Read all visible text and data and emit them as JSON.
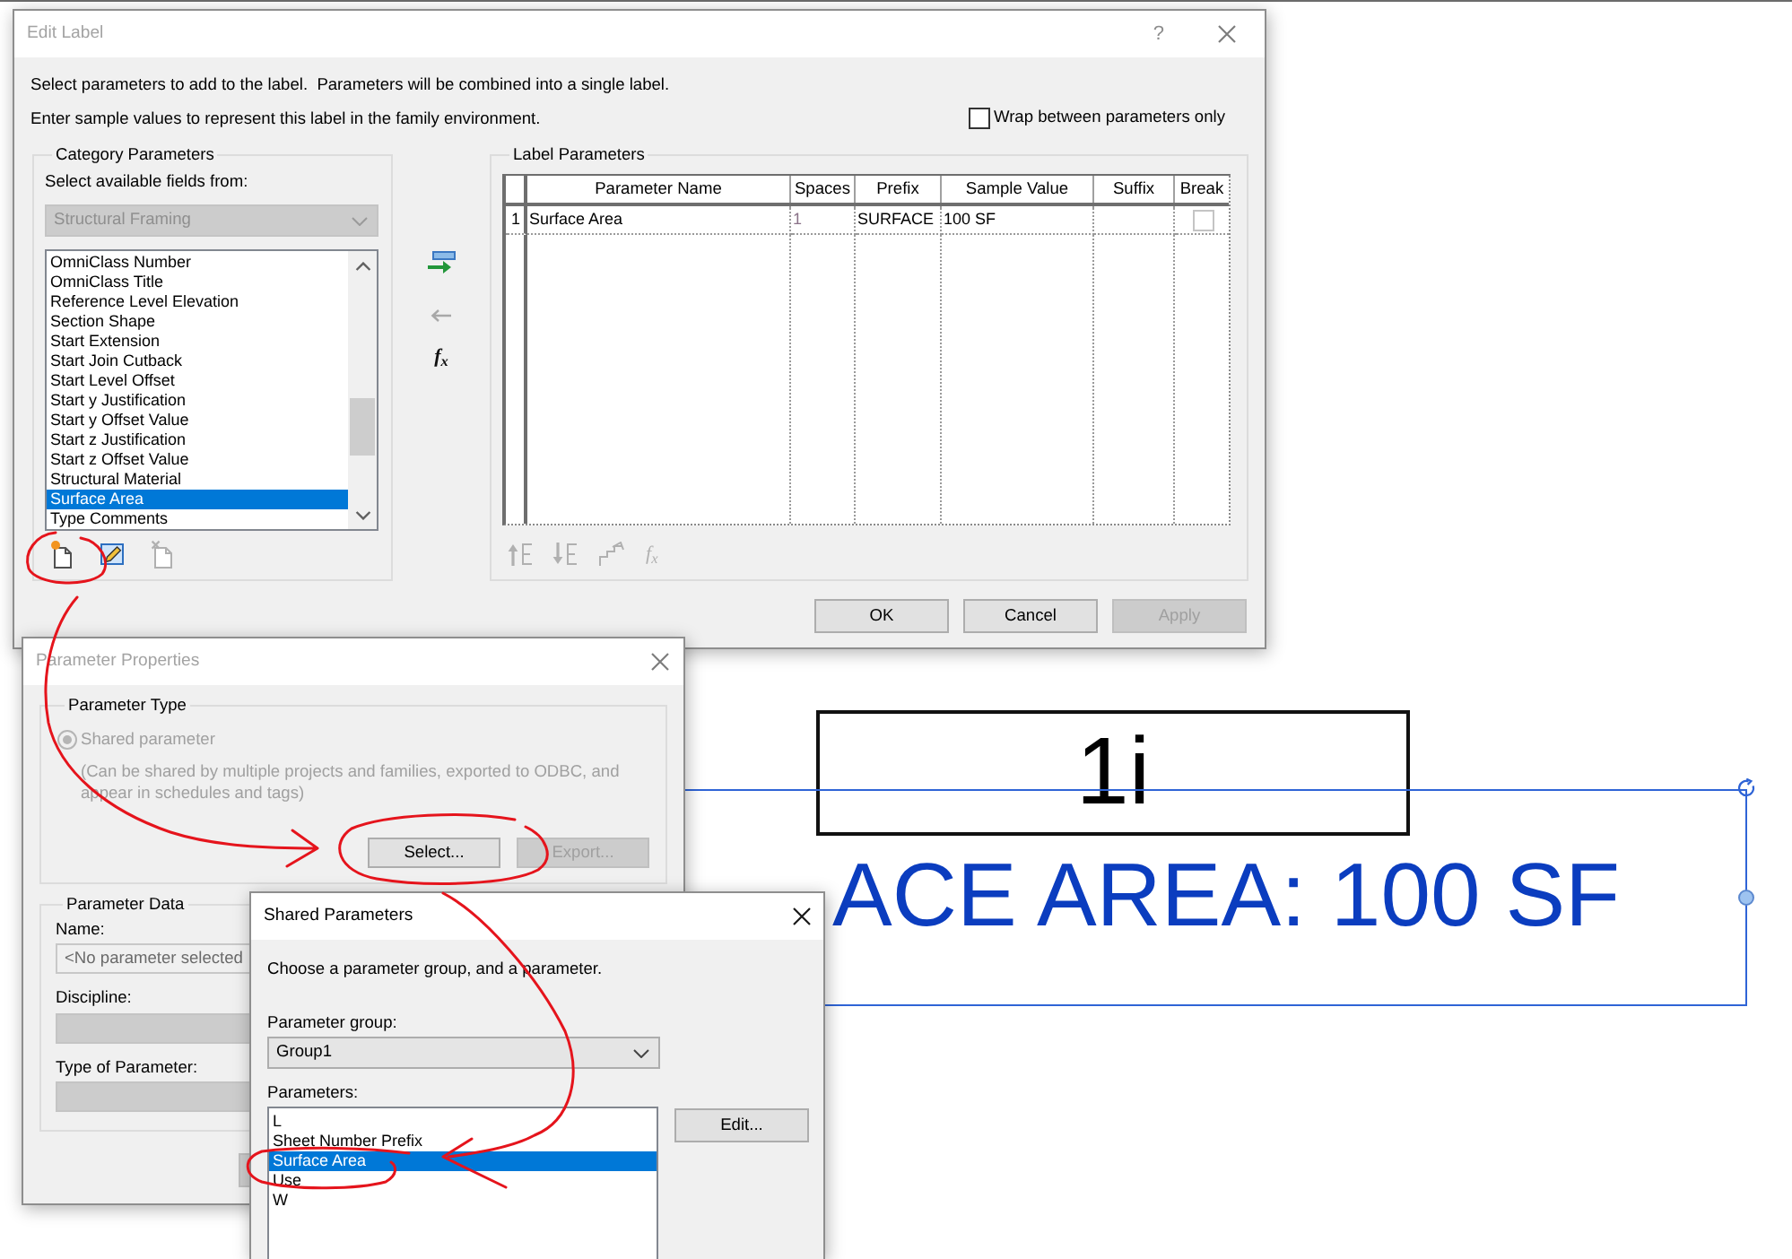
{
  "edit_label_dialog": {
    "title": "Edit Label",
    "active": false,
    "help": "?",
    "instructions": [
      "Select parameters to add to the label.  Parameters will be combined into a single label.",
      "Enter sample values to represent this label in the family environment."
    ],
    "wrap_between_parameters": {
      "label": "Wrap between parameters only",
      "checked": false
    },
    "category_parameters": {
      "title": "Category Parameters",
      "fields_label": "Select available fields from:",
      "category": {
        "value": "Structural Framing",
        "disabled": true
      },
      "fields": [
        {
          "name": "OmniClass Number",
          "selected": false
        },
        {
          "name": "OmniClass Title",
          "selected": false
        },
        {
          "name": "Reference Level Elevation",
          "selected": false
        },
        {
          "name": "Section Shape",
          "selected": false
        },
        {
          "name": "Start Extension",
          "selected": false
        },
        {
          "name": "Start Join Cutback",
          "selected": false
        },
        {
          "name": "Start Level Offset",
          "selected": false
        },
        {
          "name": "Start y Justification",
          "selected": false
        },
        {
          "name": "Start y Offset Value",
          "selected": false
        },
        {
          "name": "Start z Justification",
          "selected": false
        },
        {
          "name": "Start z Offset Value",
          "selected": false
        },
        {
          "name": "Structural Material",
          "selected": false
        },
        {
          "name": "Surface Area",
          "selected": true
        },
        {
          "name": "Type Comments",
          "selected": false
        }
      ],
      "toolbar": [
        {
          "kind": "new",
          "disabled": false
        },
        {
          "kind": "edit",
          "disabled": false
        },
        {
          "kind": "delete",
          "disabled": true
        }
      ]
    },
    "transfer_tools": [
      {
        "kind": "add",
        "disabled": false
      },
      {
        "kind": "remove",
        "disabled": true
      },
      {
        "kind": "formula",
        "label": "f$_{x}$",
        "disabled": false
      }
    ],
    "label_parameters": {
      "title": "Label Parameters",
      "columns": [
        "Parameter Name",
        "Spaces",
        "Prefix",
        "Sample Value",
        "Suffix",
        "Break"
      ],
      "rows": [
        {
          "number": "1",
          "parameter_name": "Surface Area",
          "spaces": "1",
          "prefix": "SURFACE",
          "sample_value": "100 SF",
          "break": false
        }
      ],
      "toolbar": [
        {
          "kind": "move_up",
          "disabled": true
        },
        {
          "kind": "move_down",
          "disabled": true
        },
        {
          "kind": "reorder",
          "disabled": true
        },
        {
          "kind": "formula",
          "label": "f$_{x}$",
          "disabled": true
        }
      ]
    },
    "buttons": [
      {
        "label": "OK",
        "disabled": false
      },
      {
        "label": "Cancel",
        "disabled": false
      },
      {
        "label": "Apply",
        "disabled": true
      }
    ]
  },
  "parameter_properties_dialog": {
    "title": "Parameter Properties",
    "active": false,
    "parameter_type": {
      "title": "Parameter Type",
      "shared_parameter": {
        "label": "Shared parameter",
        "selected": true,
        "disabled": true
      },
      "description": "(Can be shared by multiple projects and families, exported to ODBC, and appear in schedules and tags)",
      "buttons": [
        {
          "label": "Select...",
          "disabled": false
        },
        {
          "label": "Export...",
          "disabled": true
        }
      ]
    },
    "parameter_data": {
      "title": "Parameter Data",
      "name": {
        "label": "Name:",
        "value": "<No parameter selected",
        "disabled": true
      },
      "discipline": {
        "label": "Discipline:",
        "disabled": true
      },
      "type_of_parameter": {
        "label": "Type of Parameter:",
        "disabled": true
      }
    }
  },
  "shared_parameters_dialog": {
    "title": "Shared Parameters",
    "active": true,
    "prompt": "Choose a parameter group, and a parameter.",
    "parameter_group": {
      "label": "Parameter group:",
      "value": "Group1"
    },
    "parameters_label": "Parameters:",
    "parameters": [
      {
        "name": "L",
        "selected": false
      },
      {
        "name": "Sheet Number Prefix",
        "selected": false
      },
      {
        "name": "Surface Area",
        "selected": true
      },
      {
        "name": "Use",
        "selected": false
      },
      {
        "name": "W",
        "selected": false
      }
    ],
    "edit_button": "Edit..."
  },
  "drawing_area": {
    "tag_label": "1i",
    "label_preview": {
      "text": "ACE AREA: 100 SF",
      "selected": true
    }
  }
}
